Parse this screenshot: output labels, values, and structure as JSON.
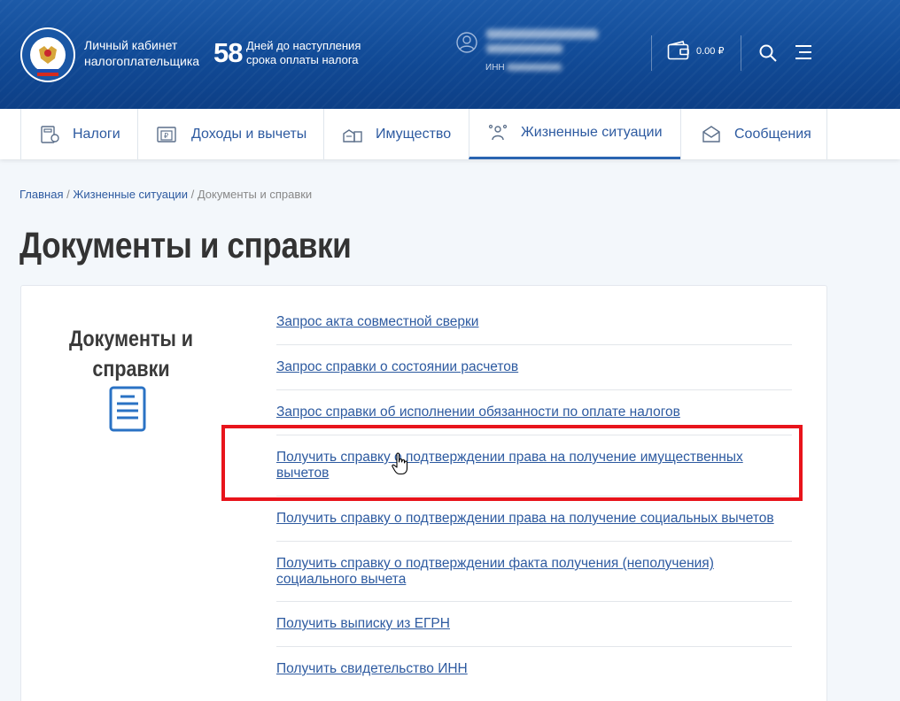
{
  "header": {
    "cabinet_line1": "Личный кабинет",
    "cabinet_line2": "налогоплательщика",
    "days_count": "58",
    "days_line1": "Дней до наступления",
    "days_line2": "срока оплаты налога",
    "inn_label": "ИНН",
    "balance": "0.00 ₽"
  },
  "nav": {
    "items": [
      {
        "label": "Налоги"
      },
      {
        "label": "Доходы и вычеты"
      },
      {
        "label": "Имущество"
      },
      {
        "label": "Жизненные ситуации"
      },
      {
        "label": "Сообщения"
      }
    ]
  },
  "breadcrumb": {
    "home": "Главная",
    "section": "Жизненные ситуации",
    "current": "Документы и справки",
    "sep": "/"
  },
  "page": {
    "title": "Документы и справки",
    "side_title_line1": "Документы и",
    "side_title_line2": "справки"
  },
  "links": [
    {
      "line1": "Запрос акта совместной сверки",
      "line2": ""
    },
    {
      "line1": "Запрос справки о состоянии расчетов",
      "line2": ""
    },
    {
      "line1": "Запрос справки об исполнении обязанности по оплате налогов",
      "line2": ""
    },
    {
      "line1": "Получить справку о подтверждении права на получение имущественных",
      "line2": "вычетов"
    },
    {
      "line1": "Получить справку о подтверждении права на получение социальных вычетов",
      "line2": ""
    },
    {
      "line1": "Получить справку о подтверждении факта получения (неполучения)",
      "line2": "социального вычета"
    },
    {
      "line1": "Получить выписку из ЕГРН",
      "line2": ""
    },
    {
      "line1": "Получить свидетельство ИНН",
      "line2": ""
    }
  ],
  "colors": {
    "header_blue": "#114a96",
    "link_blue": "#2d5aa0",
    "highlight_red": "#e8141b"
  }
}
